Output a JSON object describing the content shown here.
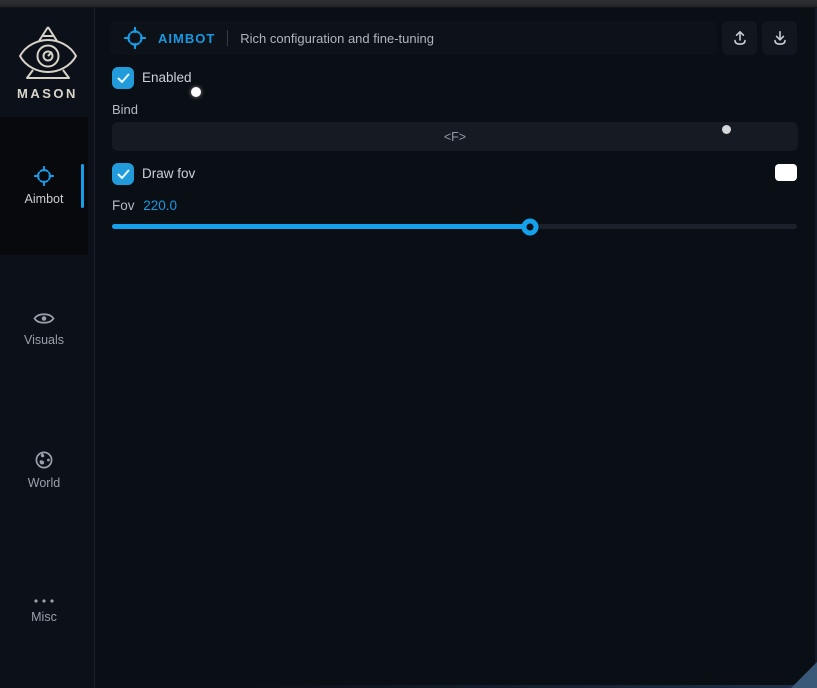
{
  "brand": {
    "name": "MASON"
  },
  "sidebar": {
    "items": [
      {
        "label": "Aimbot",
        "icon": "crosshair-icon",
        "active": true
      },
      {
        "label": "Visuals",
        "icon": "eye-icon",
        "active": false
      },
      {
        "label": "World",
        "icon": "globe-icon",
        "active": false
      },
      {
        "label": "Misc",
        "icon": "ellipsis-icon",
        "active": false
      }
    ]
  },
  "header": {
    "title": "AIMBOT",
    "subtitle": "Rich configuration and fine-tuning"
  },
  "controls": {
    "enabled_label": "Enabled",
    "bind_label": "Bind",
    "bind_value": "<F>",
    "draw_fov_label": "Draw fov",
    "draw_fov_swatch_color": "#ffffff",
    "fov_label": "Fov",
    "fov_value": "220.0",
    "fov_percent": 61
  },
  "colors": {
    "accent": "#189de8"
  }
}
